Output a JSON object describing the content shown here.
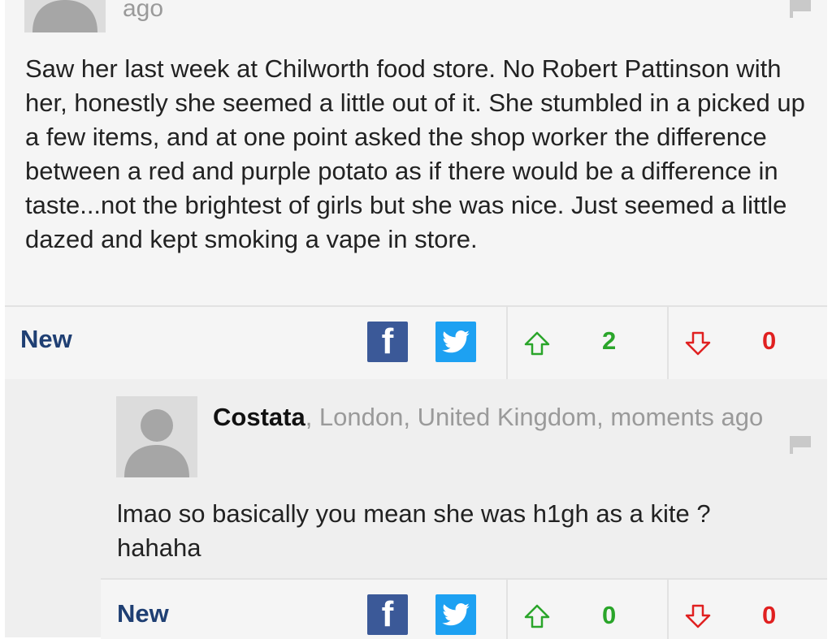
{
  "comment1": {
    "time_suffix": "ago",
    "body": "Saw her last week at Chilworth food store. No Robert Pattinson with her, honestly she seemed a little out of it. She stumbled in a picked up a few items, and at one point asked the shop worker the difference between a red and purple potato as if there would be a difference in taste...not the brightest of girls but she was nice. Just seemed a little dazed and kept smoking a vape in store.",
    "actions": {
      "new_label": "New",
      "facebook_icon": "f",
      "upvotes": "2",
      "downvotes": "0"
    }
  },
  "reply1": {
    "author": "Costata",
    "location_time": ", London, United Kingdom, moments ago",
    "body": "lmao so basically you mean she was h1gh as a kite ? hahaha",
    "actions": {
      "new_label": "New",
      "facebook_icon": "f",
      "upvotes": "0",
      "downvotes": "0"
    }
  },
  "colors": {
    "upvote": "#2aa52a",
    "downvote": "#e02020",
    "new_label": "#1f3f73",
    "facebook": "#3b5998",
    "twitter": "#1da1f2"
  }
}
